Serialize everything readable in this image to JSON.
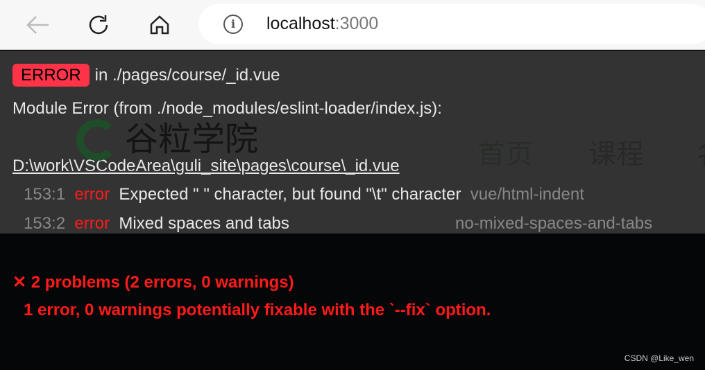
{
  "browser": {
    "url_host": "localhost",
    "url_port": ":3000"
  },
  "background_page": {
    "logo_text": "谷粒学院",
    "nav": [
      "首页",
      "课程",
      "名"
    ]
  },
  "error": {
    "badge": "ERROR",
    "file_line": "in ./pages/course/_id.vue",
    "module_error": "Module Error (from ./node_modules/eslint-loader/index.js):",
    "path": "D:\\work\\VSCodeArea\\guli_site\\pages\\course\\_id.vue",
    "rows": [
      {
        "pos": "153:1",
        "level": "error",
        "message": "Expected \" \" character, but found \"\\t\" character",
        "rule": "vue/html-indent"
      },
      {
        "pos": "153:2",
        "level": "error",
        "message": "Mixed spaces and tabs",
        "rule": "no-mixed-spaces-and-tabs"
      }
    ],
    "summary": "✕ 2 problems (2 errors, 0 warnings)",
    "fixable": "1 error, 0 warnings potentially fixable with the `--fix` option."
  },
  "watermark": "CSDN @Like_wen",
  "colors": {
    "badge": "#ff3348",
    "error": "#ff1a1a"
  }
}
